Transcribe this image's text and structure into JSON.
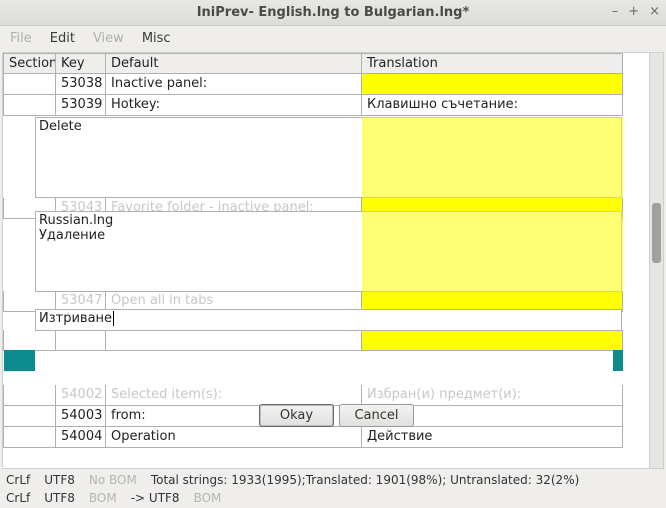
{
  "titlebar": {
    "title": "IniPrev- English.lng to Bulgarian.lng*"
  },
  "winctrls": {
    "min": "–",
    "max": "+",
    "close": "×"
  },
  "menubar": {
    "file": "File",
    "edit": "Edit",
    "view": "View",
    "misc": "Misc"
  },
  "headers": {
    "section": "Section",
    "key": "Key",
    "default": "Default",
    "translation": "Translation"
  },
  "rows": {
    "r1": {
      "section": "",
      "key": "53038",
      "default": "Inactive panel:",
      "translation": ""
    },
    "r2": {
      "section": "",
      "key": "53039",
      "default": "Hotkey:",
      "translation": "Клавишно съчетание:"
    },
    "r3": {
      "section": "",
      "key": "53043",
      "default": "Favorite folder - inactive panel:",
      "translation": ""
    },
    "r4": {
      "section": "",
      "key": "53047",
      "default": "Open all in tabs",
      "translation": ""
    },
    "r5": {
      "section": "",
      "key": "54002",
      "default": "Selected item(s):",
      "translation": "Избран(и) предмет(и):"
    },
    "r6": {
      "section": "",
      "key": "54003",
      "default": "from:",
      "translation": ""
    },
    "r7": {
      "section": "",
      "key": "54004",
      "default": "Operation",
      "translation": "Действие"
    }
  },
  "popup1": {
    "text": "Delete"
  },
  "popup2": {
    "line1": "Russian.lng",
    "line2": "Удаление"
  },
  "popup3": {
    "text": "Изтриване"
  },
  "buttons": {
    "okay": "Okay",
    "cancel": "Cancel"
  },
  "status1": {
    "crlf": "CrLf",
    "enc": "UTF8",
    "bom": "No BOM",
    "summary": "Total strings: 1933(1995);Translated: 1901(98%); Untranslated: 32(2%)"
  },
  "status2": {
    "crlf": "CrLf",
    "enc": "UTF8",
    "bom1": "BOM",
    "arrow": "-> UTF8",
    "bom2": "BOM"
  }
}
